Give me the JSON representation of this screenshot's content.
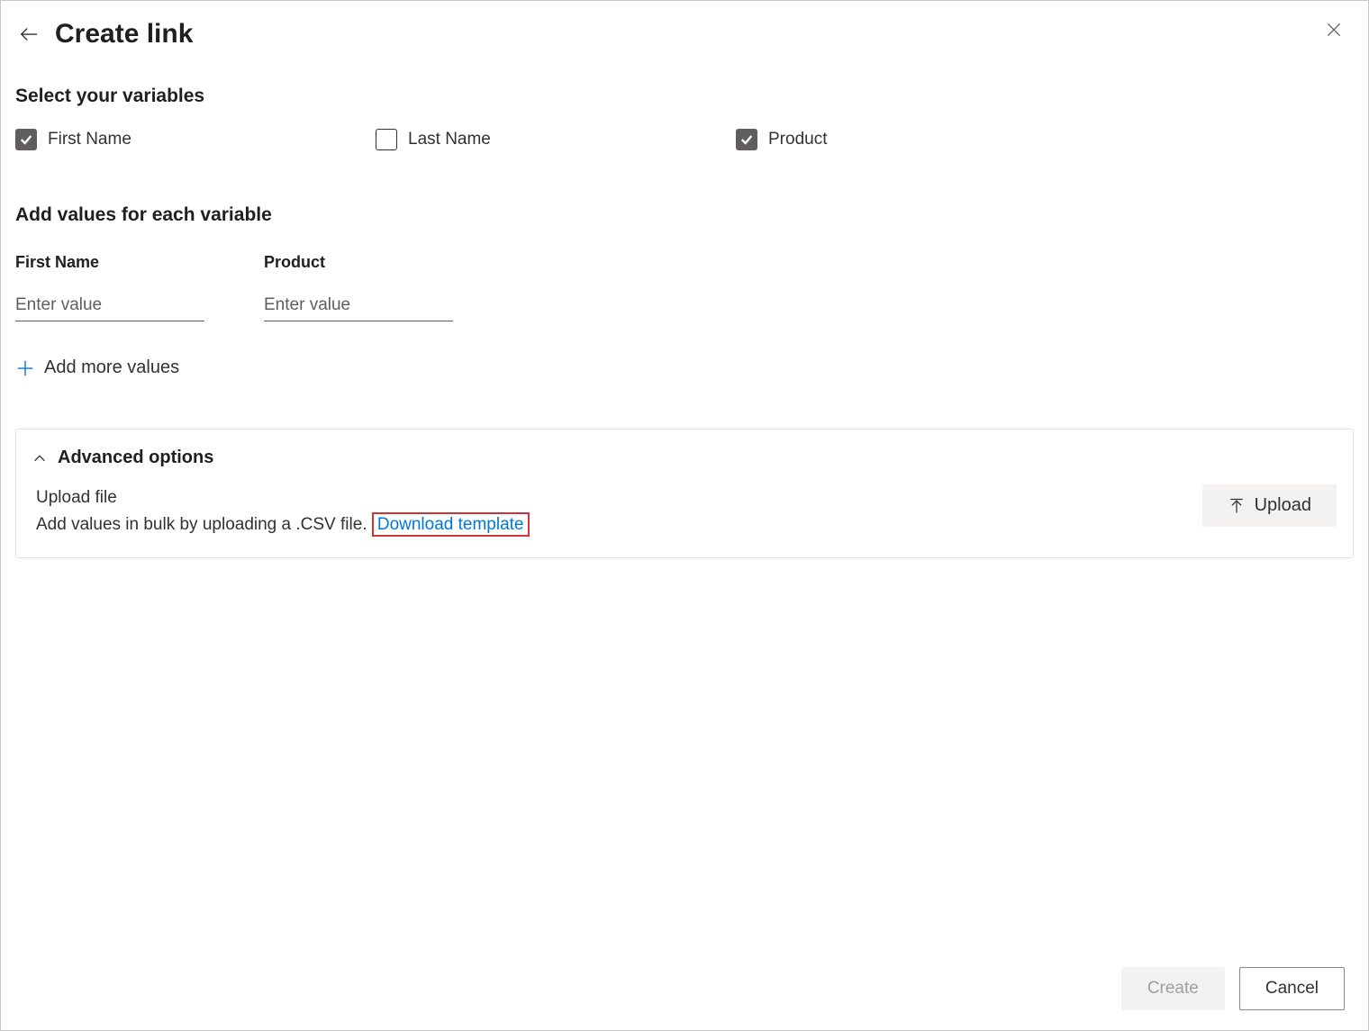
{
  "header": {
    "title": "Create link"
  },
  "sections": {
    "select_variables": {
      "heading": "Select your variables",
      "variables": [
        {
          "label": "First Name",
          "checked": true
        },
        {
          "label": "Last Name",
          "checked": false
        },
        {
          "label": "Product",
          "checked": true
        }
      ]
    },
    "add_values": {
      "heading": "Add values for each variable",
      "fields": [
        {
          "label": "First Name",
          "placeholder": "Enter value",
          "value": ""
        },
        {
          "label": "Product",
          "placeholder": "Enter value",
          "value": ""
        }
      ],
      "add_more_label": "Add more values"
    },
    "advanced": {
      "heading": "Advanced options",
      "upload_title": "Upload file",
      "upload_desc": "Add values in bulk by uploading a .CSV file.",
      "download_template_label": "Download template",
      "upload_button_label": "Upload"
    }
  },
  "footer": {
    "create_label": "Create",
    "cancel_label": "Cancel"
  }
}
